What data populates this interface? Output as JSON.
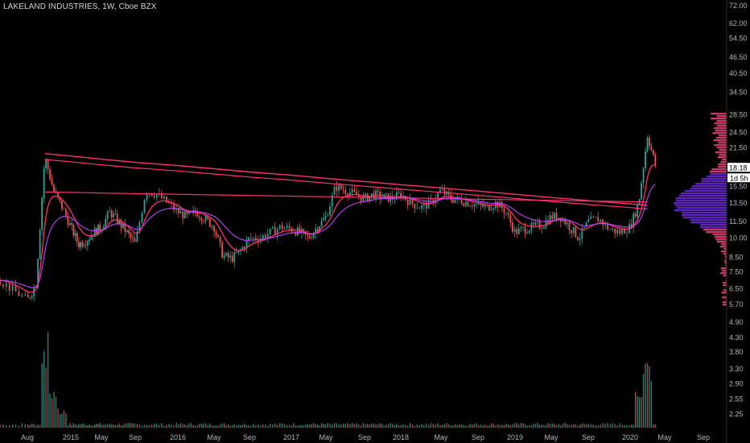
{
  "header": {
    "title": "LAKELAND INDUSTRIES, 1W, Cboe BZX"
  },
  "badges": {
    "price": "18.18",
    "countdown": "1d 5h"
  },
  "chart_data": {
    "type": "candlestick",
    "title": "LAKELAND INDUSTRIES, 1W, Cboe BZX",
    "scale": "log",
    "ylim": [
      2.0,
      72.0
    ],
    "y_ticks": [
      "72.00",
      "62.00",
      "54.50",
      "46.50",
      "40.50",
      "34.50",
      "28.50",
      "24.50",
      "21.50",
      "18.50",
      "15.50",
      "13.50",
      "11.50",
      "10.00",
      "8.50",
      "7.50",
      "6.50",
      "5.70",
      "4.90",
      "4.30",
      "3.80",
      "3.30",
      "2.90",
      "2.55",
      "2.25"
    ],
    "x_ticks": [
      "Aug",
      "2015",
      "May",
      "Sep",
      "2016",
      "May",
      "Sep",
      "2017",
      "May",
      "Sep",
      "2018",
      "May",
      "Sep",
      "2019",
      "May",
      "Sep",
      "2020",
      "May",
      "Sep"
    ],
    "last_price": 18.18,
    "price_path": [
      [
        "2014-06",
        7.0
      ],
      [
        "2014-07",
        6.4
      ],
      [
        "2014-08",
        5.9
      ],
      [
        "2014-09",
        6.8
      ],
      [
        "2014-10",
        20.0
      ],
      [
        "2014-11",
        15.0
      ],
      [
        "2014-12",
        13.0
      ],
      [
        "2015-01",
        11.0
      ],
      [
        "2015-02",
        9.5
      ],
      [
        "2015-03",
        9.8
      ],
      [
        "2015-04",
        10.5
      ],
      [
        "2015-05",
        11.0
      ],
      [
        "2015-06",
        12.5
      ],
      [
        "2015-07",
        11.5
      ],
      [
        "2015-08",
        10.5
      ],
      [
        "2015-09",
        9.5
      ],
      [
        "2015-10",
        15.0
      ],
      [
        "2015-11",
        14.5
      ],
      [
        "2015-12",
        13.5
      ],
      [
        "2016-01",
        12.5
      ],
      [
        "2016-02",
        12.0
      ],
      [
        "2016-03",
        12.5
      ],
      [
        "2016-04",
        11.8
      ],
      [
        "2016-05",
        11.0
      ],
      [
        "2016-06",
        8.6
      ],
      [
        "2016-07",
        8.4
      ],
      [
        "2016-08",
        9.0
      ],
      [
        "2016-09",
        10.0
      ],
      [
        "2016-10",
        10.0
      ],
      [
        "2016-11",
        10.5
      ],
      [
        "2016-12",
        11.0
      ],
      [
        "2017-01",
        10.8
      ],
      [
        "2017-02",
        10.5
      ],
      [
        "2017-03",
        10.0
      ],
      [
        "2017-04",
        11.0
      ],
      [
        "2017-05",
        12.0
      ],
      [
        "2017-06",
        15.5
      ],
      [
        "2017-07",
        15.0
      ],
      [
        "2017-08",
        14.5
      ],
      [
        "2017-09",
        14.0
      ],
      [
        "2017-10",
        14.5
      ],
      [
        "2017-11",
        14.2
      ],
      [
        "2017-12",
        14.0
      ],
      [
        "2018-01",
        14.5
      ],
      [
        "2018-02",
        13.5
      ],
      [
        "2018-03",
        13.0
      ],
      [
        "2018-04",
        13.5
      ],
      [
        "2018-05",
        15.0
      ],
      [
        "2018-06",
        14.0
      ],
      [
        "2018-07",
        13.8
      ],
      [
        "2018-08",
        13.5
      ],
      [
        "2018-09",
        13.2
      ],
      [
        "2018-10",
        13.0
      ],
      [
        "2018-11",
        13.5
      ],
      [
        "2018-12",
        12.5
      ],
      [
        "2019-01",
        10.5
      ],
      [
        "2019-02",
        10.8
      ],
      [
        "2019-03",
        11.0
      ],
      [
        "2019-04",
        11.2
      ],
      [
        "2019-05",
        12.0
      ],
      [
        "2019-06",
        12.0
      ],
      [
        "2019-07",
        11.0
      ],
      [
        "2019-08",
        10.0
      ],
      [
        "2019-09",
        11.5
      ],
      [
        "2019-10",
        11.8
      ],
      [
        "2019-11",
        10.8
      ],
      [
        "2019-12",
        10.5
      ],
      [
        "2020-01",
        11.0
      ],
      [
        "2020-02",
        13.5
      ],
      [
        "2020-03",
        24.0
      ],
      [
        "2020-04",
        18.18
      ]
    ],
    "volume_spikes": [
      [
        "2014-10",
        1.0
      ],
      [
        "2014-11",
        0.45
      ],
      [
        "2014-12",
        0.2
      ],
      [
        "2020-02",
        0.4
      ],
      [
        "2020-03",
        0.8
      ]
    ],
    "colors": {
      "up": "#26a69a",
      "down": "#ef5350",
      "ma_primary": "#ff2f6d",
      "ma_secondary": "#c040ff",
      "profile_pink": "#e8447a",
      "profile_purple": "#6a2bd8",
      "price_badge": "#ffffff",
      "countdown_badge": "#ffffff"
    }
  }
}
